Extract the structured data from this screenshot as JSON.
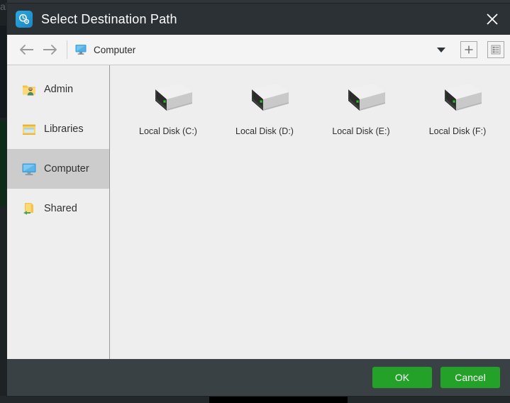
{
  "backdrop": {
    "ghost_title": "ak   Printer"
  },
  "dialog": {
    "title": "Select Destination Path",
    "app_icon": "clock-gear-icon",
    "close_icon": "close-icon"
  },
  "toolbar": {
    "back_icon": "arrow-left-icon",
    "back_label": "Back",
    "forward_icon": "arrow-right-icon",
    "forward_label": "Forward",
    "breadcrumb_icon": "computer-monitor-icon",
    "breadcrumb_text": "Computer",
    "dropdown_icon": "chevron-down-icon",
    "new_folder_icon": "plus-icon",
    "new_folder_label": "New Folder",
    "view_list_icon": "list-view-icon",
    "view_list_label": "List View"
  },
  "sidebar": {
    "items": [
      {
        "label": "Admin",
        "icon": "user-folder-icon",
        "selected": false
      },
      {
        "label": "Libraries",
        "icon": "libraries-folder-icon",
        "selected": false
      },
      {
        "label": "Computer",
        "icon": "computer-monitor-icon",
        "selected": true
      },
      {
        "label": "Shared",
        "icon": "shared-folder-icon",
        "selected": false
      }
    ]
  },
  "content": {
    "drives": [
      {
        "label": "Local Disk (C:)",
        "icon": "hard-drive-icon"
      },
      {
        "label": "Local Disk (D:)",
        "icon": "hard-drive-icon"
      },
      {
        "label": "Local Disk (E:)",
        "icon": "hard-drive-icon"
      },
      {
        "label": "Local Disk (F:)",
        "icon": "hard-drive-icon"
      }
    ]
  },
  "footer": {
    "ok_label": "OK",
    "cancel_label": "Cancel"
  },
  "colors": {
    "titlebar": "#2b3134",
    "footer": "#3a4144",
    "accent_green": "#23a128",
    "content_bg": "#eeeeee",
    "selection": "#cccccc",
    "app_icon_blue": "#2093d0",
    "drive_led_green": "#23c423"
  }
}
